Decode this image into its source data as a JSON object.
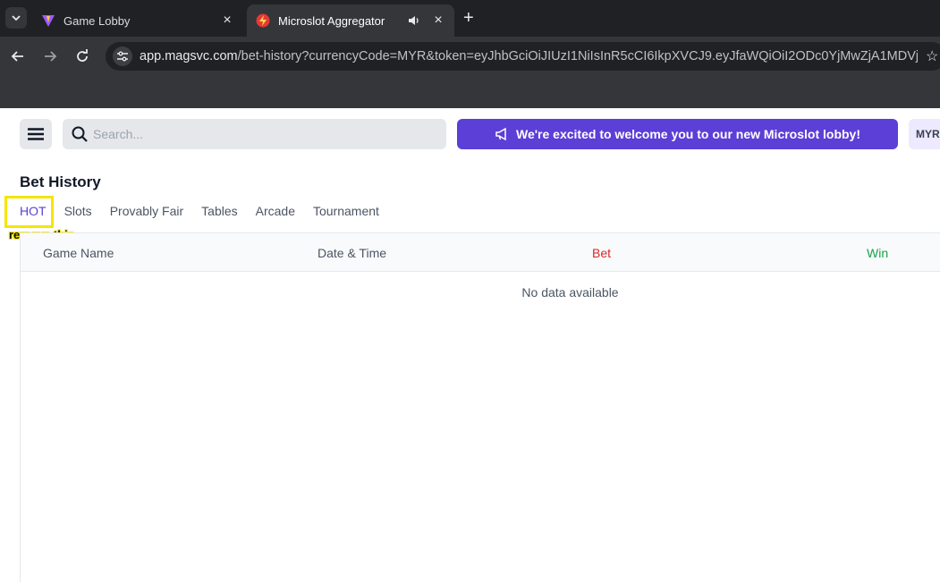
{
  "browser": {
    "tabs": [
      {
        "label": "Game Lobby",
        "active": false
      },
      {
        "label": "Microslot Aggregator",
        "active": true
      }
    ],
    "url_host": "app.magsvc.com",
    "url_path": "/bet-history?currencyCode=MYR&token=eyJhbGciOiJIUzI1NiIsInR5cCI6IkpXVCJ9.eyJfaWQiOiI2ODc0YjMwZjA1MDVjNWU5..."
  },
  "header": {
    "search_placeholder": "Search...",
    "announcement": "We're excited to welcome you to our new Microslot lobby!",
    "currency": "MYR"
  },
  "page": {
    "title": "Bet History",
    "tabs": [
      "HOT",
      "Slots",
      "Provably Fair",
      "Tables",
      "Arcade",
      "Tournament"
    ]
  },
  "annotation": {
    "label": "remove this",
    "color": "#f5e600"
  },
  "table": {
    "columns": [
      "Game Name",
      "Date & Time",
      "Bet",
      "Win"
    ],
    "empty_text": "No data available"
  },
  "colors": {
    "accent": "#5b3fd6",
    "bet": "#dc2626",
    "win": "#16a34a"
  }
}
